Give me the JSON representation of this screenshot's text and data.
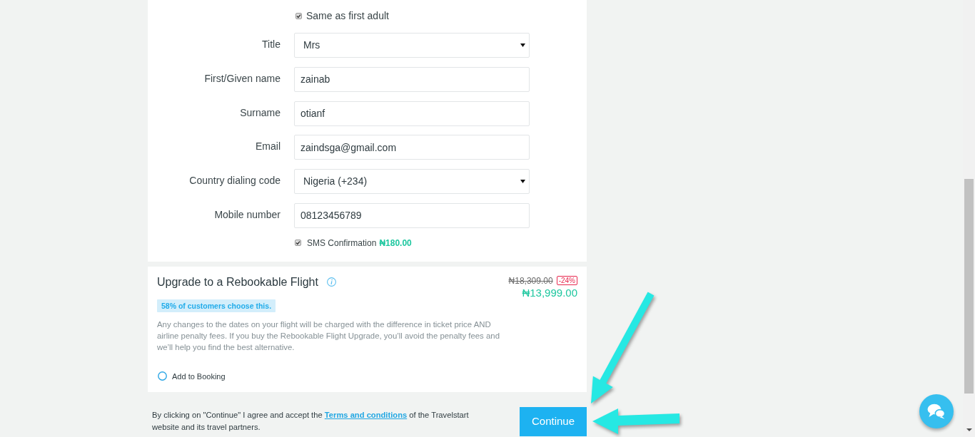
{
  "traveller_form": {
    "same_as_first_adult": {
      "label": "Same as first adult",
      "checked": true
    },
    "fields": [
      {
        "kind": "select",
        "label": "Title",
        "value": "Mrs"
      },
      {
        "kind": "text",
        "label": "First/Given name",
        "value": "zainab"
      },
      {
        "kind": "text",
        "label": "Surname",
        "value": "otianf"
      },
      {
        "kind": "text",
        "label": "Email",
        "value": "zaindsga@gmail.com"
      },
      {
        "kind": "select",
        "label": "Country dialing code",
        "value": "Nigeria (+234)"
      },
      {
        "kind": "text",
        "label": "Mobile number",
        "value": "08123456789"
      }
    ],
    "sms_confirmation": {
      "label": "SMS Confirmation",
      "price": "₦180.00",
      "checked": true
    }
  },
  "upgrade": {
    "title": "Upgrade to a Rebookable Flight",
    "popularity": "58% of customers choose this.",
    "description": "Any changes to the dates on your flight will be charged with the difference in ticket price AND airline penalty fees. If you buy the Rebookable Flight Upgrade, you’ll avoid the penalty fees and we’ll help you find the best alternative.",
    "original_price": "₦18,309.00",
    "discount": "-24%",
    "price": "₦13,999.00",
    "add_option": {
      "label": "Add to Booking",
      "selected": false
    }
  },
  "footer": {
    "terms_before": "By clicking on \"Continue\" I agree and accept the",
    "terms_link": "Terms and conditions",
    "terms_after": "of the Travelstart website and its travel partners.",
    "continue_button": "Continue"
  }
}
